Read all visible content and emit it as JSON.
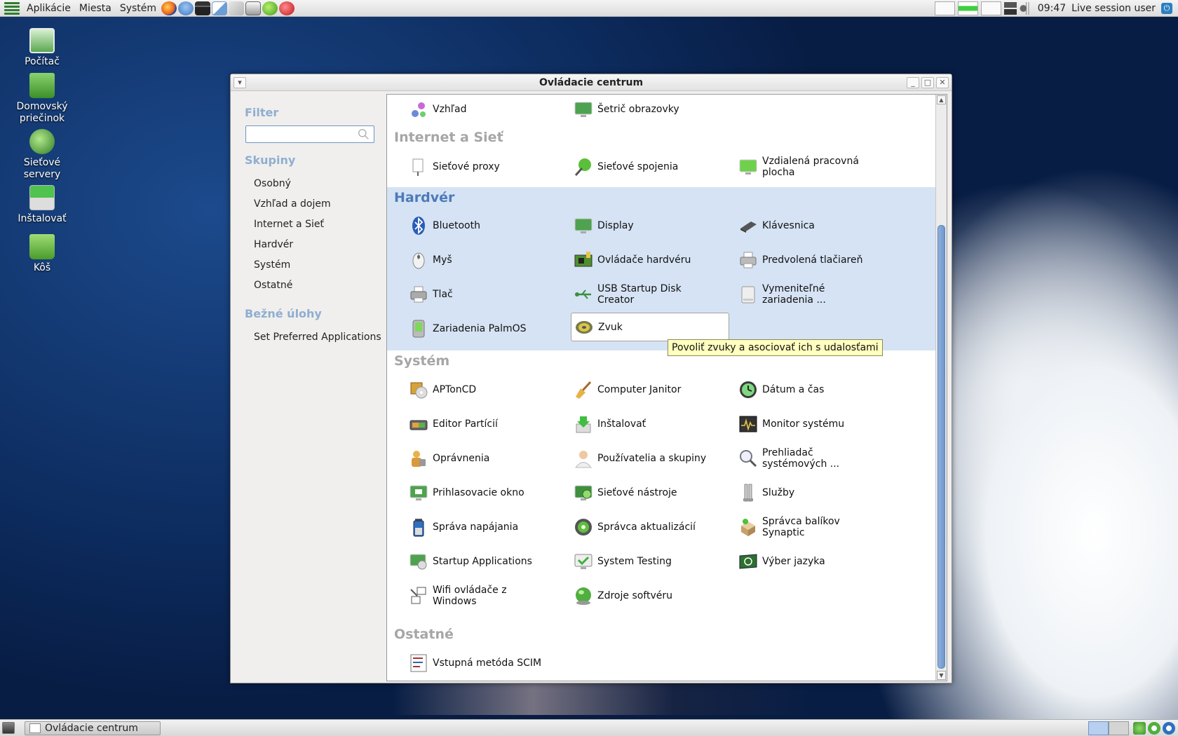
{
  "top_panel": {
    "menus": [
      "Aplikácie",
      "Miesta",
      "Systém"
    ],
    "clock": "09:47",
    "user": "Live session user"
  },
  "desktop": {
    "icons": [
      {
        "label": "Počítač",
        "icon": "computer-icon"
      },
      {
        "label": "Domovský priečinok",
        "icon": "home-folder-icon"
      },
      {
        "label": "Sieťové servery",
        "icon": "network-globe-icon"
      },
      {
        "label": "Inštalovať",
        "icon": "install-icon"
      },
      {
        "label": "Kôš",
        "icon": "trash-icon"
      }
    ]
  },
  "window": {
    "title": "Ovládacie centrum",
    "sidebar": {
      "filter_heading": "Filter",
      "search_placeholder": "",
      "groups_heading": "Skupiny",
      "groups": [
        "Osobný",
        "Vzhľad a dojem",
        "Internet a Sieť",
        "Hardvér",
        "Systém",
        "Ostatné"
      ],
      "tasks_heading": "Bežné úlohy",
      "tasks": [
        "Set Preferred Applications"
      ]
    },
    "sections": {
      "personal_tail": {
        "items": [
          "Vzhľad",
          "Šetrič obrazovky"
        ]
      },
      "internet": {
        "title": "Internet a Sieť",
        "items": [
          "Sieťové proxy",
          "Sieťové spojenia",
          "Vzdialená pracovná plocha"
        ]
      },
      "hardware": {
        "title": "Hardvér",
        "items": [
          "Bluetooth",
          "Display",
          "Klávesnica",
          "Myš",
          "Ovládače hardvéru",
          "Predvolená tlačiareň",
          "Tlač",
          "USB Startup Disk Creator",
          "Vymeniteľné zariadenia ...",
          "Zariadenia PalmOS",
          "Zvuk"
        ]
      },
      "system": {
        "title": "Systém",
        "items": [
          "APTonCD",
          "Computer Janitor",
          "Dátum a čas",
          "Editor Partícií",
          "Inštalovať",
          "Monitor systému",
          "Oprávnenia",
          "Používatelia a skupiny",
          "Prehliadač systémových ...",
          "Prihlasovacie okno",
          "Sieťové nástroje",
          "Služby",
          "Správa napájania",
          "Správca aktualizácií",
          "Správca balíkov Synaptic",
          "Startup Applications",
          "System Testing",
          "Výber jazyka",
          "Wifi ovládače z Windows",
          "Zdroje softvéru"
        ]
      },
      "other": {
        "title": "Ostatné",
        "items": [
          "Vstupná metóda SCIM"
        ]
      }
    },
    "tooltip": "Povoliť zvuky a asociovať ich s udalosťami"
  },
  "bottom_panel": {
    "task": "Ovládacie centrum"
  },
  "colors": {
    "highlight_section": "#d5e3f4",
    "section_title_active": "#4d7ab8",
    "section_title": "#a6a6a6",
    "sidebar_heading": "#8faed0"
  }
}
